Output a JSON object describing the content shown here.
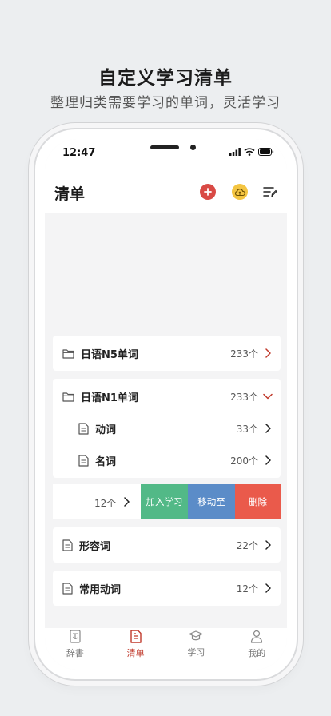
{
  "promo": {
    "title": "自定义学习清单",
    "subtitle": "整理归类需要学习的单词，灵活学习"
  },
  "status_bar": {
    "time": "12:47"
  },
  "header": {
    "title": "清单",
    "add_icon": "plus-icon",
    "cloud_icon": "cloud-upload-icon",
    "edit_icon": "list-edit-icon"
  },
  "lists": [
    {
      "name": "日语N5单词",
      "count": "233个",
      "type": "folder",
      "expanded": false
    },
    {
      "name": "日语N1单词",
      "count": "233个",
      "type": "folder",
      "expanded": true,
      "children": [
        {
          "name": "动词",
          "count": "33个"
        },
        {
          "name": "名词",
          "count": "200个"
        }
      ]
    },
    {
      "name": "",
      "count": "12个",
      "type": "file",
      "swiped": true
    },
    {
      "name": "形容词",
      "count": "22个",
      "type": "file"
    },
    {
      "name": "常用动词",
      "count": "12个",
      "type": "file"
    }
  ],
  "swipe_actions": {
    "learn": "加入学习",
    "move": "移动至",
    "delete": "删除"
  },
  "tabs": [
    {
      "label": "辞書",
      "icon": "dictionary-icon"
    },
    {
      "label": "清单",
      "icon": "list-icon",
      "active": true
    },
    {
      "label": "学习",
      "icon": "graduation-cap-icon"
    },
    {
      "label": "我的",
      "icon": "user-icon"
    }
  ],
  "colors": {
    "accent": "#c0392b",
    "add": "#d94a45",
    "cloud": "#f4c542",
    "learn": "#52b987",
    "move": "#5b8cc8",
    "delete": "#ea5a4b"
  }
}
